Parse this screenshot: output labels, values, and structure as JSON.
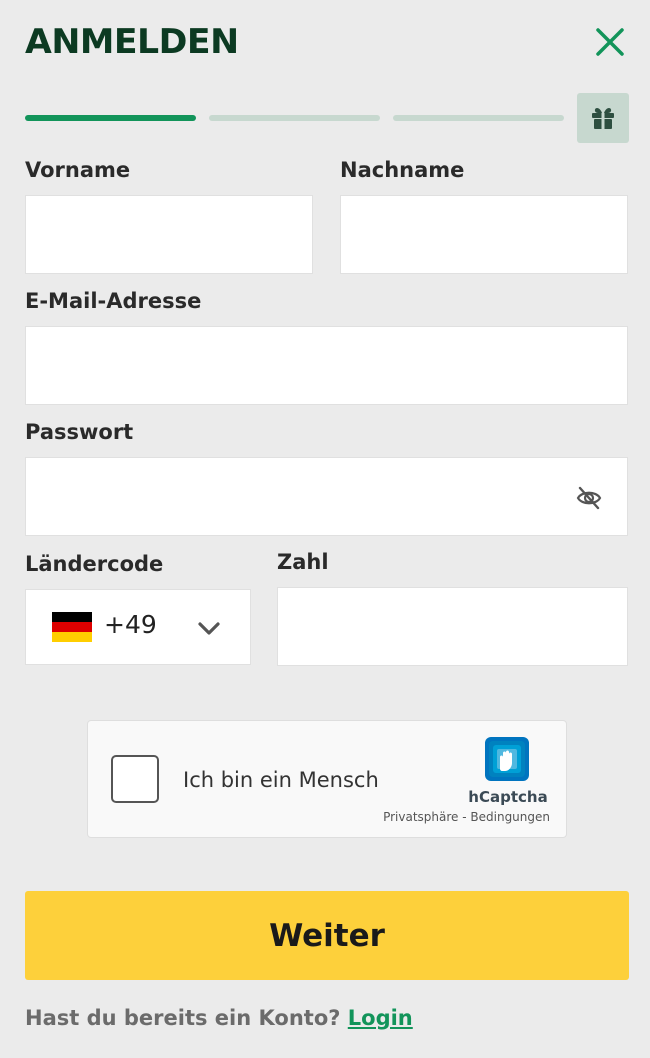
{
  "header": {
    "title": "ANMELDEN"
  },
  "progress": {
    "steps_total": 3,
    "steps_done": 1
  },
  "form": {
    "first_name": {
      "label": "Vorname",
      "value": "",
      "placeholder": ""
    },
    "last_name": {
      "label": "Nachname",
      "value": "",
      "placeholder": ""
    },
    "email": {
      "label": "E-Mail-Adresse",
      "value": "",
      "placeholder": ""
    },
    "password": {
      "label": "Passwort",
      "value": "",
      "placeholder": ""
    },
    "country_code": {
      "label": "Ländercode",
      "value": "+49",
      "flag": "Germany"
    },
    "number": {
      "label": "Zahl",
      "value": "",
      "placeholder": ""
    }
  },
  "captcha": {
    "text": "Ich bin ein Mensch",
    "brand": "hCaptcha",
    "privacy_label": "Privatsphäre",
    "separator": " - ",
    "terms_label": "Bedingungen"
  },
  "actions": {
    "continue_label": "Weiter"
  },
  "footer": {
    "prompt": "Hast du bereits ein Konto?",
    "login_label": "Login"
  },
  "colors": {
    "brand_dark_green": "#0c3a22",
    "accent_green": "#12945a",
    "progress_inactive": "#c7d8cf",
    "button_yellow": "#fdd03b",
    "background": "#ebebeb"
  },
  "icons": [
    "close-icon",
    "gift-icon",
    "eye-off-icon",
    "german-flag-icon",
    "chevron-down-icon",
    "hcaptcha-logo-icon"
  ]
}
